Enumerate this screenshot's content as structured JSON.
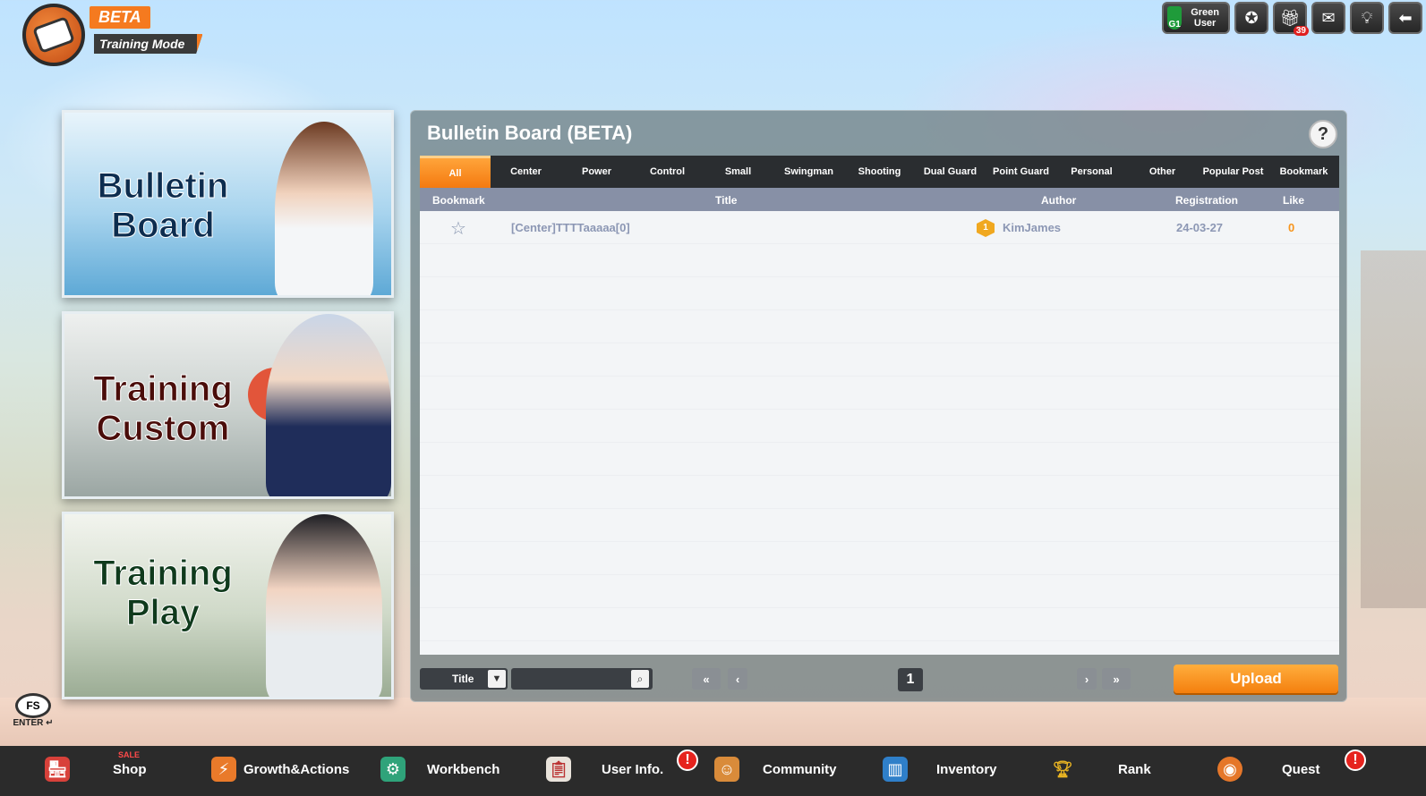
{
  "logo": {
    "beta": "BETA",
    "mode": "Training Mode"
  },
  "topbar": {
    "user_grade": "G1",
    "user_name": "Green User",
    "gift_count": "39"
  },
  "cards": {
    "bulletin": [
      "Bulletin",
      "Board"
    ],
    "custom": [
      "Training",
      "Custom"
    ],
    "play": [
      "Training",
      "Play"
    ]
  },
  "board": {
    "title": "Bulletin Board (BETA)",
    "help": "?",
    "tabs": [
      "All",
      "Center",
      "Power",
      "Control",
      "Small",
      "Swingman",
      "Shooting",
      "Dual Guard",
      "Point Guard",
      "Personal",
      "Other",
      "Popular Post",
      "Bookmark"
    ],
    "active_tab": "All",
    "columns": {
      "bookmark": "Bookmark",
      "title": "Title",
      "author": "Author",
      "registration": "Registration",
      "like": "Like"
    },
    "posts": [
      {
        "title": "[Center]TTTTaaaaa[0]",
        "author_level": "1",
        "author": "KimJames",
        "registration": "24-03-27",
        "like": "0"
      }
    ],
    "search_type": "Title",
    "search_placeholder": "",
    "page": "1",
    "upload": "Upload"
  },
  "chat": {
    "icon_text": "FS",
    "enter": "ENTER ↵"
  },
  "nav": [
    {
      "label": "Shop",
      "badge": "SALE"
    },
    {
      "label": "Growth&Actions"
    },
    {
      "label": "Workbench"
    },
    {
      "label": "User Info.",
      "alert": "!"
    },
    {
      "label": "Community"
    },
    {
      "label": "Inventory"
    },
    {
      "label": "Rank"
    },
    {
      "label": "Quest",
      "alert": "!"
    }
  ],
  "colors": {
    "accent": "#f47a10",
    "panel": "#6e7d82",
    "nav_bg": "#2b2b2b"
  }
}
